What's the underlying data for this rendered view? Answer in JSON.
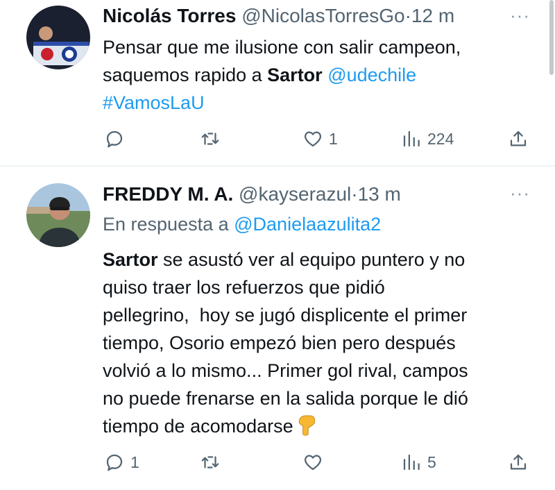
{
  "tweets": [
    {
      "author": "Nicolás Torres",
      "handle": "@NicolasTorresGo",
      "separator": "·",
      "time": "12 m",
      "more": "···",
      "text": {
        "line1": "Pensar que me ilusione con salir campeon,",
        "line2_pre": "saquemos rapido a ",
        "line2_bold": "Sartor",
        "line2_space": " ",
        "line2_mention": "@udechile",
        "hashtag": "#VamosLaU"
      },
      "actions": {
        "replies": "",
        "retweets": "",
        "likes": "1",
        "views": "224"
      }
    },
    {
      "author": "FREDDY M. A.",
      "handle": "@kayserazul",
      "separator": "·",
      "time": "13 m",
      "more": "···",
      "reply_prefix": "En respuesta a ",
      "reply_to": "@Danielaazulita2",
      "text": {
        "bold": "Sartor",
        "l1": " se asustó ver al equipo puntero y no",
        "l2": "quiso traer los refuerzos que pidió",
        "l3": "pellegrino,  hoy se jugó displicente el primer",
        "l4": "tiempo, Osorio empezó bien pero después",
        "l5": "volvió a lo mismo... Primer gol rival, campos",
        "l6": "no puede frenarse en la salida porque le dió",
        "l7": "tiempo de acomodarse"
      },
      "actions": {
        "replies": "1",
        "retweets": "",
        "likes": "",
        "views": "5"
      }
    }
  ],
  "colors": {
    "link": "#1d9bf0",
    "muted": "#536471",
    "text": "#0f1419",
    "divider": "#eff3f4"
  }
}
